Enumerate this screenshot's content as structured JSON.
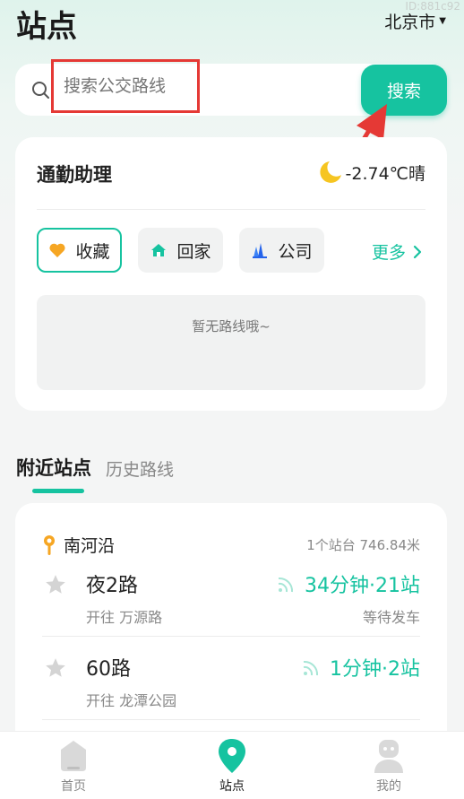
{
  "watermark": "ID:881c92",
  "header": {
    "title": "站点",
    "city": "北京市",
    "city_caret": "▼"
  },
  "search": {
    "placeholder": "搜索公交路线",
    "button_label": "搜索"
  },
  "commute": {
    "title": "通勤助理",
    "weather": "-2.74℃晴",
    "chips": {
      "favorite": "收藏",
      "home": "回家",
      "work": "公司"
    },
    "more_label": "更多",
    "empty_text": "暂无路线哦~"
  },
  "tabs": {
    "active": "附近站点",
    "inactive": "历史路线"
  },
  "station": {
    "name": "南河沿",
    "meta": "1个站台 746.84米",
    "routes": [
      {
        "name": "夜2路",
        "destination": "开往 万源路",
        "eta": "34分钟·21站",
        "status": "等待发车"
      },
      {
        "name": "60路",
        "destination": "开往 龙潭公园",
        "eta": "1分钟·2站",
        "status": ""
      }
    ]
  },
  "nav": {
    "home": "首页",
    "station": "站点",
    "mine": "我的"
  },
  "colors": {
    "accent": "#16c3a0",
    "highlight_border": "#e53935",
    "arrow": "#e53935"
  }
}
